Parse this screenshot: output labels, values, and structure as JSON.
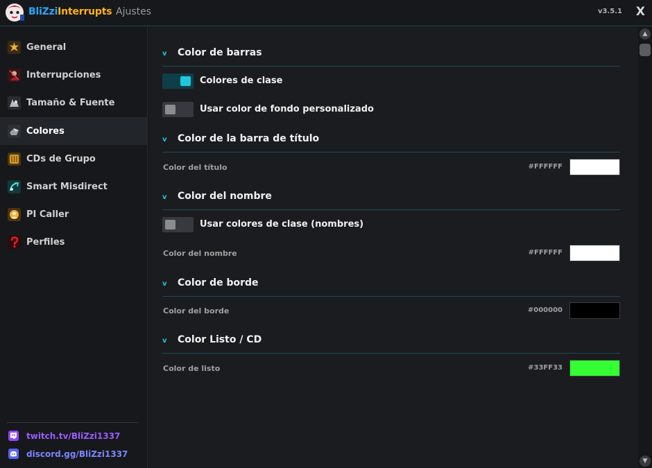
{
  "app": {
    "brand_part1": "BliZzi",
    "brand_part2": "Interrupts",
    "subtitle": "Ajustes",
    "version": "v3.5.1",
    "close_label": "X"
  },
  "sidebar": {
    "items": [
      {
        "label": "General",
        "icon": "gear-spark-icon"
      },
      {
        "label": "Interrupciones",
        "icon": "interrupt-icon"
      },
      {
        "label": "Tamaño & Fuente",
        "icon": "size-font-icon"
      },
      {
        "label": "Colores",
        "icon": "colors-icon"
      },
      {
        "label": "CDs de Grupo",
        "icon": "group-cds-icon"
      },
      {
        "label": "Smart Misdirect",
        "icon": "misdirect-icon"
      },
      {
        "label": "PI Caller",
        "icon": "pi-caller-icon"
      },
      {
        "label": "Perfiles",
        "icon": "question-mark-icon"
      }
    ],
    "active": "Colores",
    "links": {
      "twitch": "twitch.tv/BliZzi1337",
      "discord": "discord.gg/BliZzi1337"
    }
  },
  "sections": {
    "bar_color": {
      "title": "Color de barras",
      "class_colors_label": "Colores de clase",
      "class_colors_on": true,
      "custom_bg_label": "Usar color de fondo personalizado",
      "custom_bg_on": false
    },
    "title_bar_color": {
      "title": "Color de la barra de título",
      "field_label": "Color del título",
      "hex": "#FFFFFF",
      "color": "#FFFFFF"
    },
    "name_color": {
      "title": "Color del nombre",
      "class_names_label": "Usar colores de clase (nombres)",
      "class_names_on": false,
      "field_label": "Color del nombre",
      "hex": "#FFFFFF",
      "color": "#FFFFFF"
    },
    "border_color": {
      "title": "Color de borde",
      "field_label": "Color del borde",
      "hex": "#000000",
      "color": "#000000"
    },
    "ready_color": {
      "title": "Color Listo / CD",
      "field_label": "Color de listo",
      "hex": "#33FF33",
      "color": "#33FF33"
    }
  },
  "colors": {
    "accent": "#1EC8D8",
    "brand_blue": "#2AA8FF",
    "brand_orange": "#FFB21A",
    "twitch": "#9A5CFF",
    "discord": "#7B86FF"
  }
}
